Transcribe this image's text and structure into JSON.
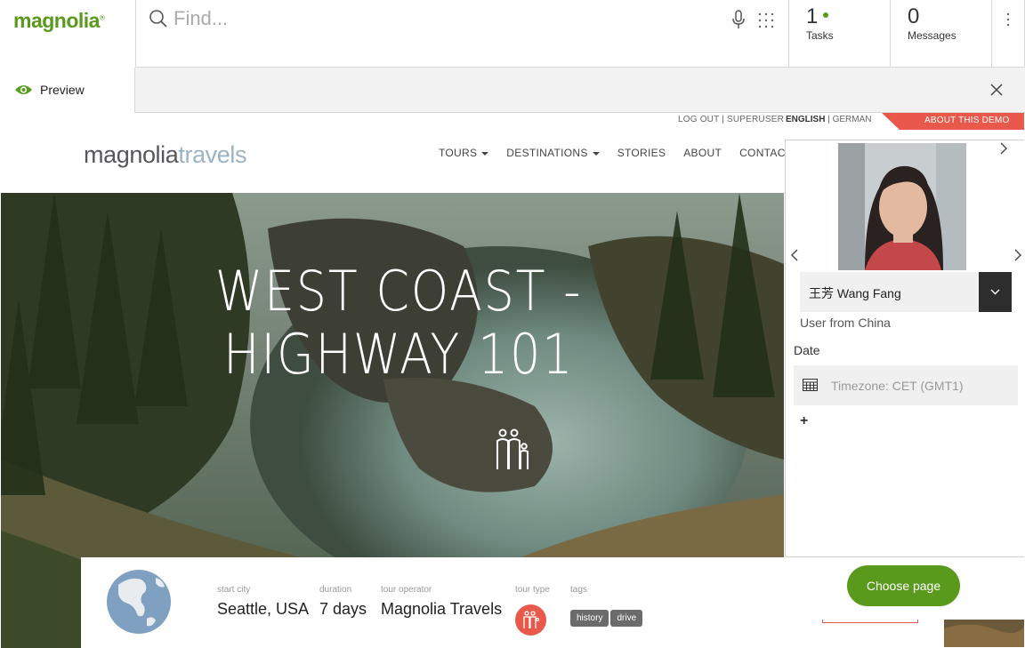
{
  "app": {
    "logo": "magnolia"
  },
  "search": {
    "placeholder": "Find..."
  },
  "counters": {
    "tasks": {
      "value": "1",
      "label": "Tasks"
    },
    "messages": {
      "value": "0",
      "label": "Messages"
    }
  },
  "preview": {
    "label": "Preview"
  },
  "site": {
    "util_nav": "LOG OUT | SUPERUSER",
    "lang_active": "ENGLISH",
    "lang_sep": " | ",
    "lang_other": "GERMAN",
    "demo": "ABOUT THIS DEMO",
    "logo_a": "magnolia",
    "logo_b": "travels",
    "nav": [
      "TOURS",
      "DESTINATIONS",
      "STORIES",
      "ABOUT",
      "CONTACT"
    ],
    "hero_line1": "WEST COAST -",
    "hero_line2": "HIGHWAY 101"
  },
  "panel": {
    "persona": "王芳 Wang Fang",
    "description": "User from China",
    "date_label": "Date",
    "timezone_placeholder": "Timezone: CET (GMT1)",
    "add": "+"
  },
  "info": {
    "start_city_label": "start city",
    "start_city": "Seattle, USA",
    "duration_label": "duration",
    "duration": "7 days",
    "operator_label": "tour operator",
    "operator": "Magnolia Travels",
    "type_label": "tour type",
    "tags_label": "tags",
    "tags": [
      "history",
      "drive"
    ]
  },
  "choose_page": "Choose page",
  "colors": {
    "brand_green": "#599a1d",
    "accent_red": "#e8594b",
    "dark": "#2d2d2d"
  }
}
